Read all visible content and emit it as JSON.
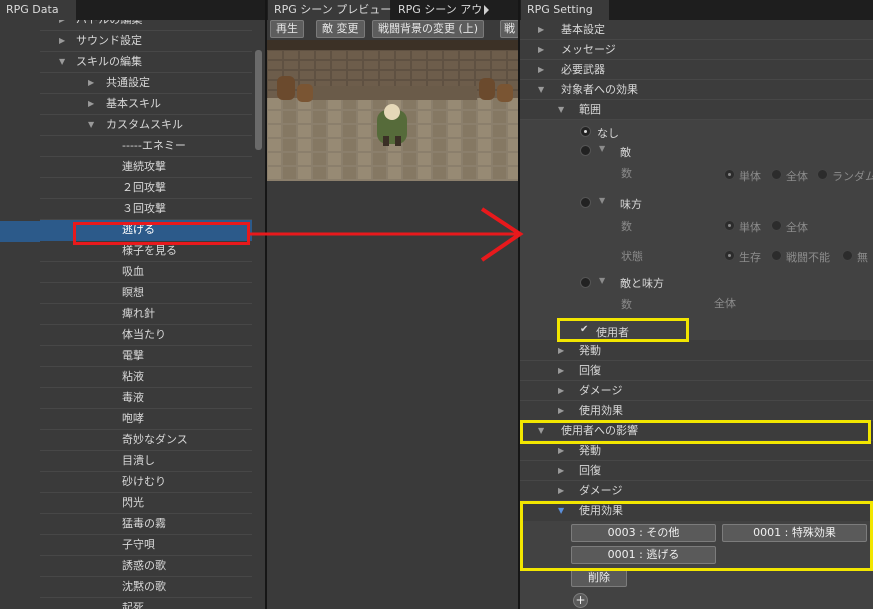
{
  "tabs": {
    "data": "RPG Data",
    "preview": "RPG シーン プレビュー",
    "outline": "RPG シーン アウ",
    "setting": "RPG Setting"
  },
  "preview_toolbar": {
    "play": "再生",
    "change_enemy": "敵 変更",
    "change_bg": "戦闘背景の変更 (上)",
    "more": "戦"
  },
  "data_tree": [
    {
      "label": "バトルの編集",
      "indent": 1,
      "arrow": "right"
    },
    {
      "label": "サウンド設定",
      "indent": 1,
      "arrow": "right"
    },
    {
      "label": "スキルの編集",
      "indent": 1,
      "arrow": "down"
    },
    {
      "label": "共通設定",
      "indent": 2,
      "arrow": "right"
    },
    {
      "label": "基本スキル",
      "indent": 2,
      "arrow": "right"
    },
    {
      "label": "カスタムスキル",
      "indent": 2,
      "arrow": "down"
    },
    {
      "label": "-----エネミー",
      "indent": 3
    },
    {
      "label": "連続攻撃",
      "indent": 3
    },
    {
      "label": "２回攻撃",
      "indent": 3
    },
    {
      "label": "３回攻撃",
      "indent": 3
    },
    {
      "label": "逃げる",
      "indent": 3,
      "selected": true
    },
    {
      "label": "様子を見る",
      "indent": 3
    },
    {
      "label": "吸血",
      "indent": 3
    },
    {
      "label": "瞑想",
      "indent": 3
    },
    {
      "label": "痺れ針",
      "indent": 3
    },
    {
      "label": "体当たり",
      "indent": 3
    },
    {
      "label": "電撃",
      "indent": 3
    },
    {
      "label": "粘液",
      "indent": 3
    },
    {
      "label": "毒液",
      "indent": 3
    },
    {
      "label": "咆哮",
      "indent": 3
    },
    {
      "label": "奇妙なダンス",
      "indent": 3
    },
    {
      "label": "目潰し",
      "indent": 3
    },
    {
      "label": "砂けむり",
      "indent": 3
    },
    {
      "label": "閃光",
      "indent": 3
    },
    {
      "label": "猛毒の霧",
      "indent": 3
    },
    {
      "label": "子守唄",
      "indent": 3
    },
    {
      "label": "誘惑の歌",
      "indent": 3
    },
    {
      "label": "沈黙の歌",
      "indent": 3
    },
    {
      "label": "起死",
      "indent": 3
    }
  ],
  "setting": {
    "basic": "基本設定",
    "message": "メッセージ",
    "required_weapon": "必要武器",
    "target_effect": "対象者への効果",
    "range": "範囲",
    "none": "なし",
    "enemy": "敵",
    "count": "数",
    "single": "単体",
    "all": "全体",
    "random": "ランダム",
    "ally": "味方",
    "status": "状態",
    "alive": "生存",
    "knocked_out": "戦闘不能",
    "none_status": "無",
    "enemy_and_ally": "敵と味方",
    "user": "使用者",
    "check": "✔",
    "activation": "発動",
    "recovery": "回復",
    "damage": "ダメージ",
    "use_effect": "使用効果",
    "user_influence": "使用者への影響",
    "effects": [
      "0003 : その他",
      "0001 : 特殊効果",
      "0001 : 逃げる"
    ],
    "delete": "削除",
    "add": "+"
  },
  "colors": {
    "selection": "#2c5a8a",
    "highlight_red": "#e8191c",
    "highlight_yellow": "#f2e600"
  }
}
